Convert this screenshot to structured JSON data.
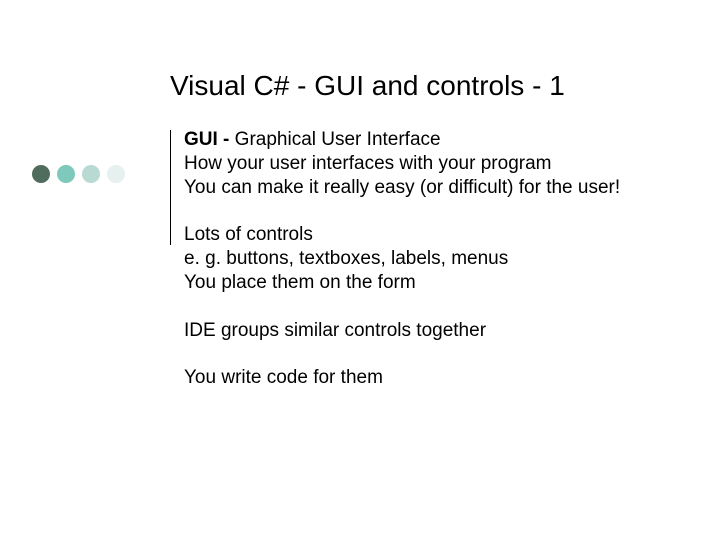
{
  "title": "Visual C# - GUI and controls - 1",
  "blocks": {
    "block1": {
      "line1_bold": "GUI - ",
      "line1_rest": "Graphical User Interface",
      "line2": "How your user interfaces with your program",
      "line3": "You can make it really easy (or difficult) for the user!"
    },
    "block2": {
      "line1": "Lots of controls",
      "line2": "e. g. buttons, textboxes, labels, menus",
      "line3": "You place them on the form"
    },
    "block3": {
      "line1": "IDE groups similar controls together"
    },
    "block4": {
      "line1": "You write code for them"
    }
  }
}
